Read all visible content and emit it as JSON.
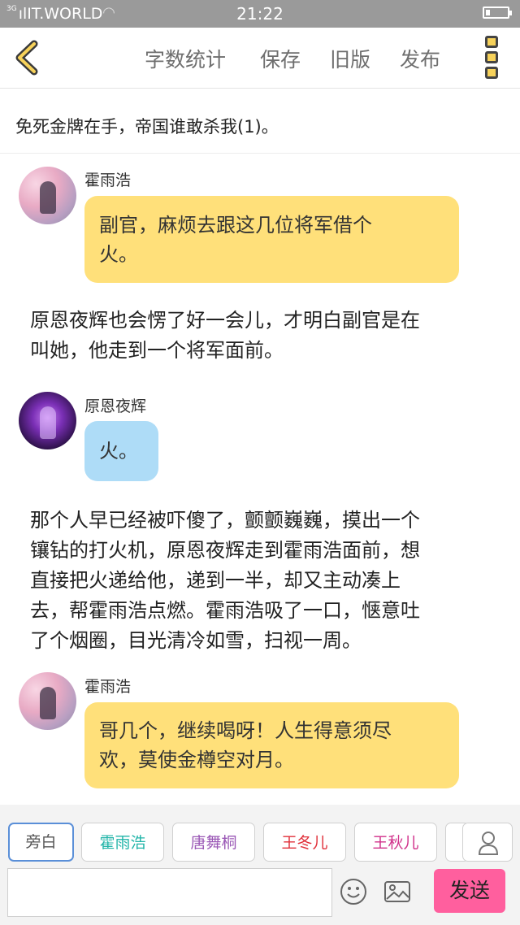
{
  "status_bar": {
    "network": "3G",
    "carrier": "IT.WORLD",
    "time": "21:22",
    "icons": [
      "signal-icon",
      "wifi-icon",
      "battery-icon"
    ]
  },
  "toolbar": {
    "back_icon": "chevron-left-icon",
    "word_count": "字数统计",
    "save": "保存",
    "old_version": "旧版",
    "publish": "发布",
    "more_icon": "vertical-dots-icon",
    "accent": "#f7d25a"
  },
  "story": {
    "title": "免死金牌在手，帝国谁敢杀我(1)。"
  },
  "messages": [
    {
      "speaker": "霍雨浩",
      "text_line1": "副官，麻烦去跟这几位将军借个",
      "text_line2": "火。"
    },
    {
      "narration_line1": "原恩夜辉也会愣了好一会儿，才明白副官是在",
      "narration_line2": "叫她，他走到一个将军面前。"
    },
    {
      "speaker": "原恩夜辉",
      "text_line1": "火。"
    },
    {
      "narration_line1": "那个人早已经被吓傻了，颤颤巍巍，摸出一个",
      "narration_line2": "镶钻的打火机，原恩夜辉走到霍雨浩面前，想",
      "narration_line3": "直接把火递给他，递到一半，却又主动凑上",
      "narration_line4": "去，帮霍雨浩点燃。霍雨浩吸了一口，惬意吐",
      "narration_line5": "了个烟圈，目光清冷如雪，扫视一周。"
    },
    {
      "speaker": "霍雨浩",
      "text_line1": "哥几个，继续喝呀！人生得意须尽",
      "text_line2": "欢，莫使金樽空对月。"
    }
  ],
  "characters": [
    {
      "label": "旁白",
      "color": "#555555"
    },
    {
      "label": "霍雨浩",
      "color": "#20b4a8"
    },
    {
      "label": "唐舞桐",
      "color": "#9b59b6"
    },
    {
      "label": "王冬儿",
      "color": "#e0303a"
    },
    {
      "label": "王秋儿",
      "color": "#d0308a"
    }
  ],
  "composer": {
    "input_value": "",
    "emoji_icon": "smiley-icon",
    "image_icon": "image-icon",
    "user_icon": "user-icon",
    "send": "发送",
    "send_color": "#ff5f9e"
  },
  "colors": {
    "bubble_yellow": "#ffe07a",
    "bubble_blue": "#aedcf7"
  }
}
